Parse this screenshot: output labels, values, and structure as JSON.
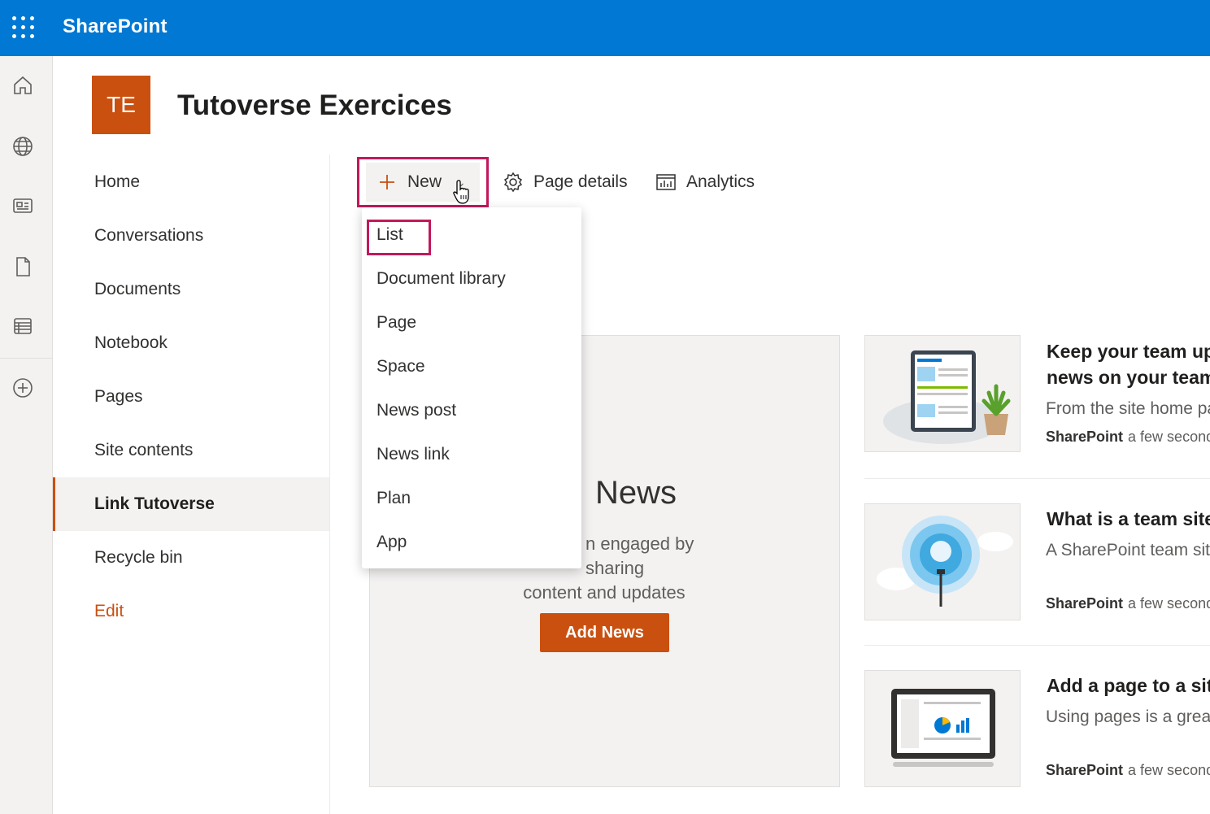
{
  "app": {
    "brand": "SharePoint"
  },
  "site": {
    "logo_initials": "TE",
    "title": "Tutoverse Exercices"
  },
  "nav": {
    "items": [
      {
        "label": "Home"
      },
      {
        "label": "Conversations"
      },
      {
        "label": "Documents"
      },
      {
        "label": "Notebook"
      },
      {
        "label": "Pages"
      },
      {
        "label": "Site contents"
      },
      {
        "label": "Link Tutoverse",
        "active": true
      },
      {
        "label": "Recycle bin"
      }
    ],
    "edit_label": "Edit"
  },
  "rail_icons": [
    "home-icon",
    "globe-icon",
    "news-icon",
    "file-icon",
    "list-icon",
    "add-circle-icon"
  ],
  "commands": {
    "new_label": "New",
    "page_details_label": "Page details",
    "analytics_label": "Analytics"
  },
  "new_menu": {
    "items": [
      "List",
      "Document library",
      "Page",
      "Space",
      "News post",
      "News link",
      "Plan",
      "App"
    ],
    "highlighted": "List"
  },
  "news": {
    "heading": "News",
    "description_line1": "n engaged by sharing",
    "description_line2": "content and updates",
    "add_button": "Add News"
  },
  "cards": [
    {
      "title_line1": "Keep your team up",
      "title_line2": "news on your team",
      "desc": "From the site home pa",
      "author": "SharePoint",
      "time": "a few second"
    },
    {
      "title_line1": "What is a team site",
      "title_line2": "",
      "desc": "A SharePoint team site",
      "author": "SharePoint",
      "time": "a few second"
    },
    {
      "title_line1": "Add a page to a sit",
      "title_line2": "",
      "desc": "Using pages is a great",
      "author": "SharePoint",
      "time": "a few second"
    }
  ],
  "colors": {
    "brand_blue": "#0078d4",
    "accent_orange": "#ca5010",
    "highlight_magenta": "#c2185b"
  }
}
